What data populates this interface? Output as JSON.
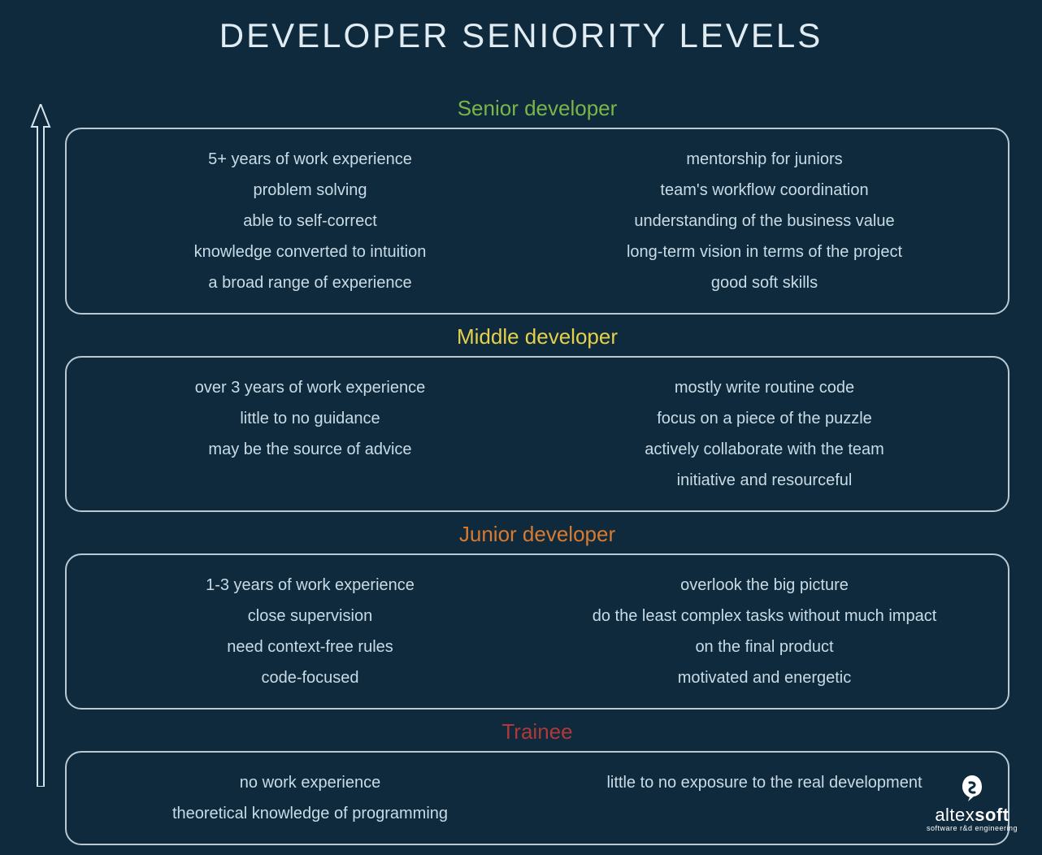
{
  "title": "DEVELOPER SENIORITY LEVELS",
  "levels": [
    {
      "name": "Senior developer",
      "class": "title-senior",
      "left": [
        "5+ years of work experience",
        "problem solving",
        "able to self-correct",
        "knowledge converted to intuition",
        "a broad range of experience"
      ],
      "right": [
        "mentorship for juniors",
        "team's workflow coordination",
        "understanding of the business value",
        "long-term vision in terms of the project",
        "good soft skills"
      ]
    },
    {
      "name": "Middle developer",
      "class": "title-middle",
      "left": [
        "over 3 years of work experience",
        "little to no guidance",
        "may be the source of advice"
      ],
      "right": [
        "mostly write routine code",
        "focus on a piece of the puzzle",
        "actively collaborate with the team",
        "initiative and resourceful"
      ]
    },
    {
      "name": "Junior developer",
      "class": "title-junior",
      "left": [
        "1-3 years of work experience",
        "close supervision",
        "need context-free rules",
        "code-focused"
      ],
      "right": [
        "overlook the big picture",
        "do the least complex tasks  without much impact",
        "on the final product",
        "motivated and energetic"
      ]
    },
    {
      "name": "Trainee",
      "class": "title-trainee",
      "left": [
        "no work experience",
        "theoretical knowledge of programming"
      ],
      "right": [
        "little to no exposure  to the real development"
      ]
    }
  ],
  "logo": {
    "brand_prefix": "altex",
    "brand_suffix": "soft",
    "tagline": "software r&d engineering"
  }
}
